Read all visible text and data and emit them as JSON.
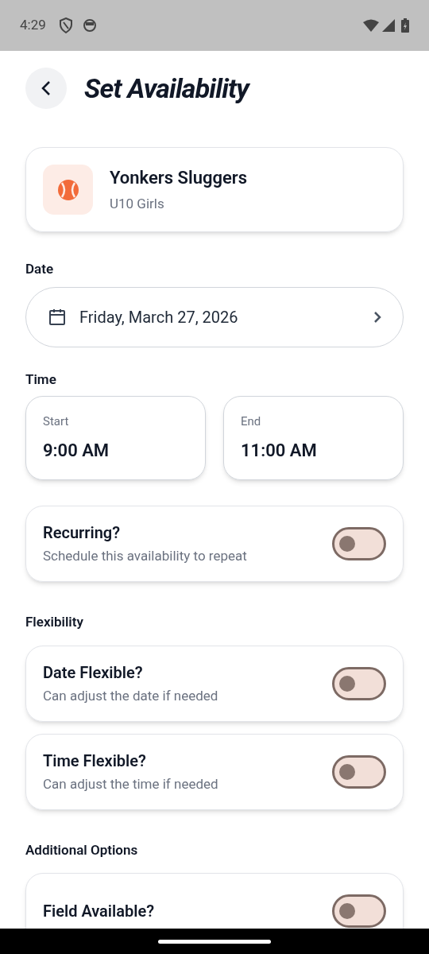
{
  "status_bar": {
    "time": "4:29"
  },
  "header": {
    "title": "Set Availability"
  },
  "team": {
    "name": "Yonkers Sluggers",
    "subtitle": "U10 Girls"
  },
  "date": {
    "label": "Date",
    "value": "Friday, March 27, 2026"
  },
  "time": {
    "label": "Time",
    "start": {
      "label": "Start",
      "value": "9:00 AM"
    },
    "end": {
      "label": "End",
      "value": "11:00 AM"
    }
  },
  "sections": [
    {
      "toggles": [
        {
          "title": "Recurring?",
          "subtitle": "Schedule this availability to repeat",
          "on": false
        }
      ]
    },
    {
      "heading": "Flexibility",
      "toggles": [
        {
          "title": "Date Flexible?",
          "subtitle": "Can adjust the date if needed",
          "on": false
        },
        {
          "title": "Time Flexible?",
          "subtitle": "Can adjust the time if needed",
          "on": false
        }
      ]
    },
    {
      "heading": "Additional Options",
      "toggles": [
        {
          "title": "Field Available?",
          "on": false
        }
      ]
    }
  ]
}
